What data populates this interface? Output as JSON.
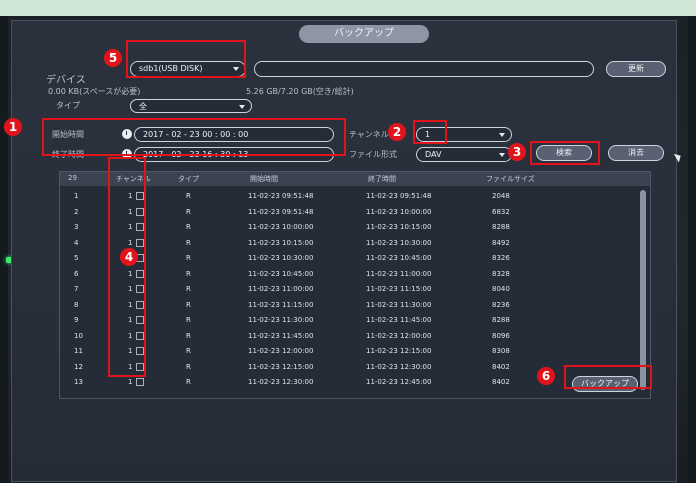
{
  "title": "バックアップ",
  "device": {
    "label": "デバイス",
    "selected": "sdb1(USB DISK)",
    "path_value": "",
    "refresh_label": "更新"
  },
  "space": {
    "required": "0.00 KB(スペースが必要)",
    "free_total": "5.26 GB/7.20 GB(空き/総計)"
  },
  "type": {
    "label": "タイプ",
    "value": "全"
  },
  "start": {
    "label": "開始時間",
    "value": "2017 - 02 - 23   00 : 00 : 00"
  },
  "end": {
    "label": "終了時間",
    "value": "2017 - 02 - 23   16 : 30 : 13"
  },
  "channel": {
    "label": "チャンネル",
    "value": "1"
  },
  "format": {
    "label": "ファイル形式",
    "value": "DAV"
  },
  "buttons": {
    "search": "検索",
    "clear": "消去",
    "backup": "バックアップ"
  },
  "table": {
    "headers": [
      "29",
      "チャンネル",
      "タイプ",
      "開始時間",
      "終了時間",
      "ファイルサイズ"
    ],
    "rows": [
      {
        "n": "1",
        "ch": "1",
        "type": "R",
        "start": "11-02-23 09:51:48",
        "end": "11-02-23 09:51:48",
        "size": "2048"
      },
      {
        "n": "2",
        "ch": "1",
        "type": "R",
        "start": "11-02-23 09:51:48",
        "end": "11-02-23 10:00:00",
        "size": "6832"
      },
      {
        "n": "3",
        "ch": "1",
        "type": "R",
        "start": "11-02-23 10:00:00",
        "end": "11-02-23 10:15:00",
        "size": "8288"
      },
      {
        "n": "4",
        "ch": "1",
        "type": "R",
        "start": "11-02-23 10:15:00",
        "end": "11-02-23 10:30:00",
        "size": "8492"
      },
      {
        "n": "5",
        "ch": "1",
        "type": "R",
        "start": "11-02-23 10:30:00",
        "end": "11-02-23 10:45:00",
        "size": "8326"
      },
      {
        "n": "6",
        "ch": "1",
        "type": "R",
        "start": "11-02-23 10:45:00",
        "end": "11-02-23 11:00:00",
        "size": "8328"
      },
      {
        "n": "7",
        "ch": "1",
        "type": "R",
        "start": "11-02-23 11:00:00",
        "end": "11-02-23 11:15:00",
        "size": "8040"
      },
      {
        "n": "8",
        "ch": "1",
        "type": "R",
        "start": "11-02-23 11:15:00",
        "end": "11-02-23 11:30:00",
        "size": "8236"
      },
      {
        "n": "9",
        "ch": "1",
        "type": "R",
        "start": "11-02-23 11:30:00",
        "end": "11-02-23 11:45:00",
        "size": "8288"
      },
      {
        "n": "10",
        "ch": "1",
        "type": "R",
        "start": "11-02-23 11:45:00",
        "end": "11-02-23 12:00:00",
        "size": "8096"
      },
      {
        "n": "11",
        "ch": "1",
        "type": "R",
        "start": "11-02-23 12:00:00",
        "end": "11-02-23 12:15:00",
        "size": "8308"
      },
      {
        "n": "12",
        "ch": "1",
        "type": "R",
        "start": "11-02-23 12:15:00",
        "end": "11-02-23 12:30:00",
        "size": "8402"
      },
      {
        "n": "13",
        "ch": "1",
        "type": "R",
        "start": "11-02-23 12:30:00",
        "end": "11-02-23 12:45:00",
        "size": "8402"
      }
    ]
  },
  "annotations": [
    "1",
    "2",
    "3",
    "4",
    "5",
    "6"
  ],
  "colors": {
    "highlight": "#e2141b",
    "dialog_bg": "#262c37",
    "led": "#3cf06a"
  }
}
